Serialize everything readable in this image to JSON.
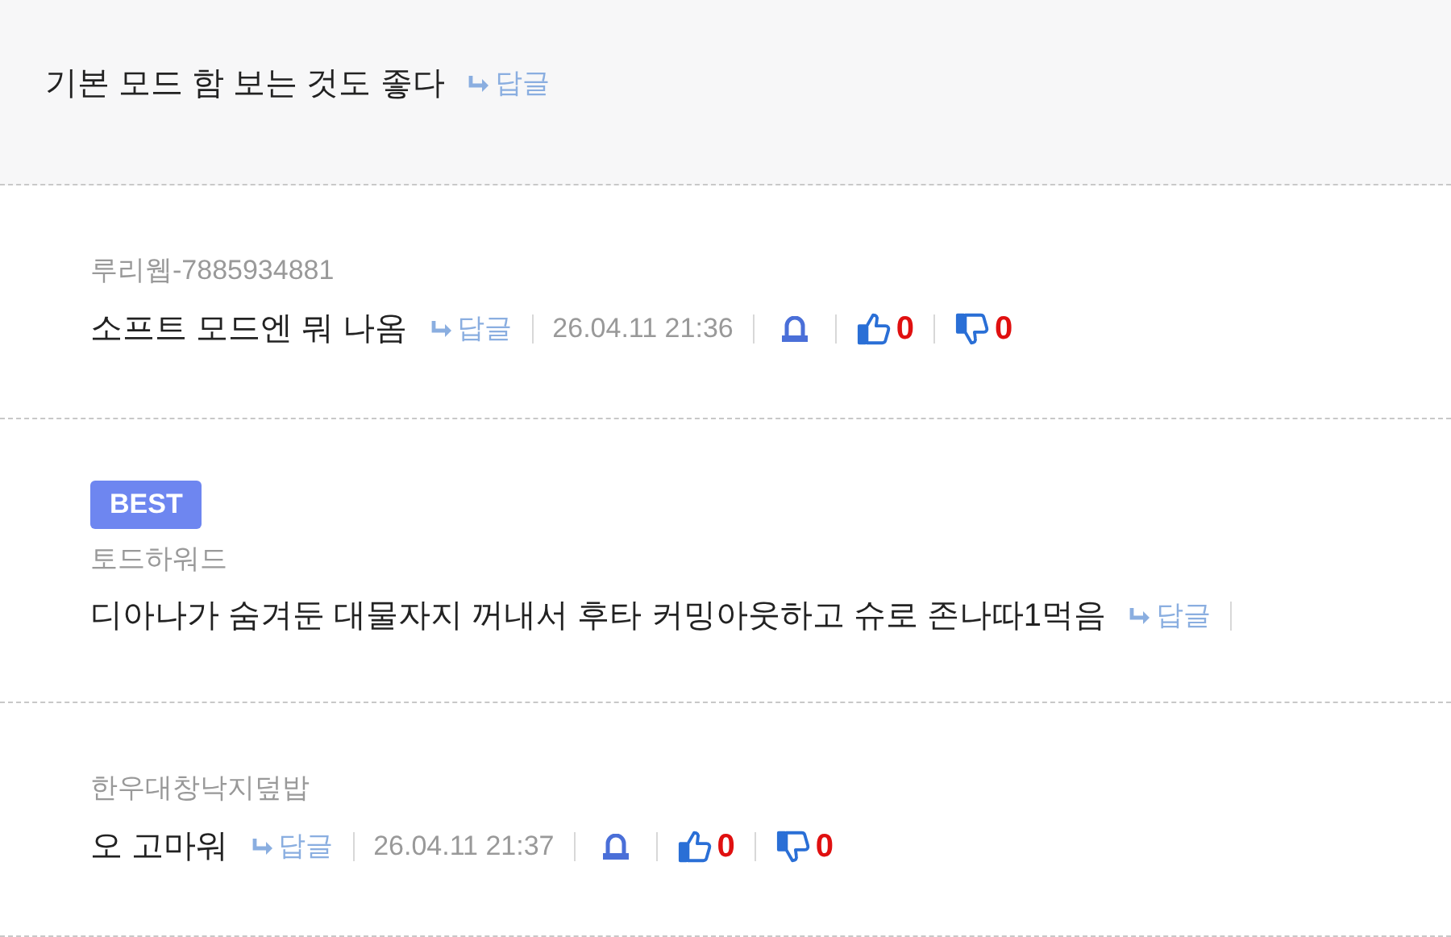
{
  "top_comment": {
    "text": "기본 모드 함 보는 것도 좋다",
    "reply_label": "답글"
  },
  "replies": [
    {
      "best": false,
      "author": "루리웹-7885934881",
      "text": "소프트 모드엔 뭐 나옴",
      "reply_label": "답글",
      "date": "26.04.11 21:36",
      "likes": "0",
      "dislikes": "0"
    },
    {
      "best": true,
      "badge": "BEST",
      "author": "토드하워드",
      "text": "디아나가 숨겨둔 대물자지 꺼내서 후타 커밍아웃하고 슈로 존나따1먹음",
      "reply_label": "답글"
    },
    {
      "best": false,
      "author": "한우대창낙지덮밥",
      "text": "오 고마워",
      "reply_label": "답글",
      "date": "26.04.11 21:37",
      "likes": "0",
      "dislikes": "0"
    }
  ]
}
